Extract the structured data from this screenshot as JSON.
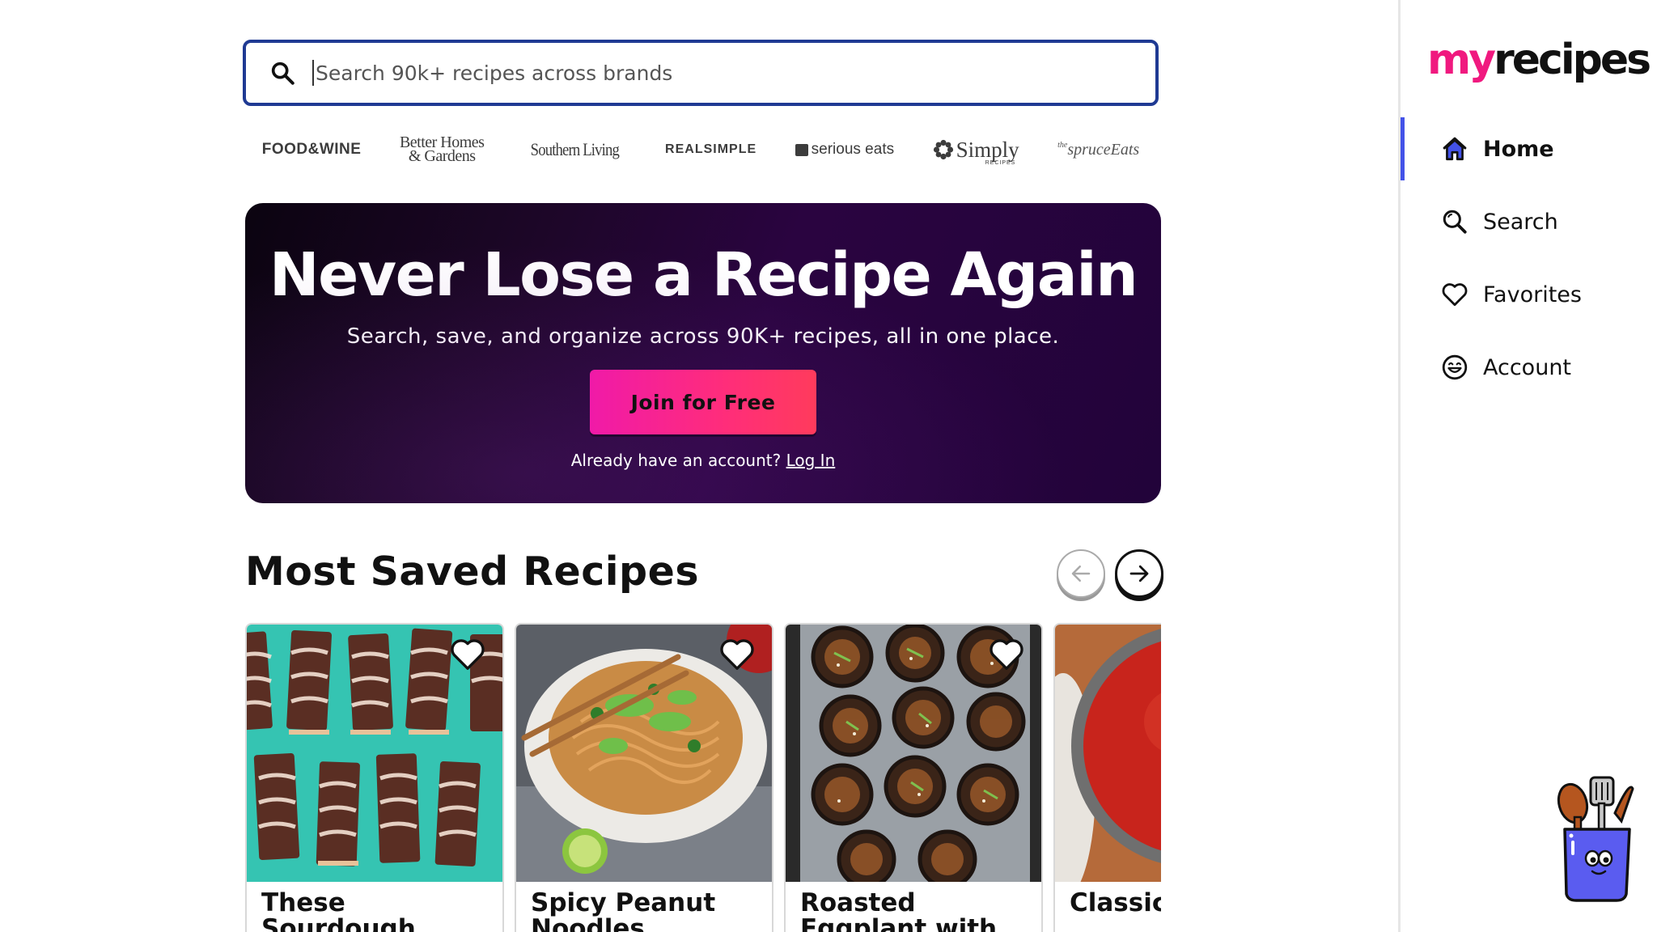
{
  "search": {
    "placeholder": "Search 90k+ recipes across brands"
  },
  "brands": [
    "FOOD&WINE",
    "Better Homes & Gardens",
    "Southern Living",
    "REAL SIMPLE",
    "serious eats",
    "Simply Recipes",
    "the spruce Eats"
  ],
  "brand_display": {
    "food_wine": "FOOD&WINE",
    "bhg_line1": "Better Homes",
    "bhg_line2": "& Gardens",
    "southern_living": "Southern Living",
    "real_simple": "REALSIMPLE",
    "serious_eats": "serious eats",
    "simply": "Simply",
    "simply_sub": "RECIPES",
    "spruce_the": "the",
    "spruce": "spruceEats"
  },
  "hero": {
    "title": "Never Lose a Recipe Again",
    "subtitle": "Search, save, and organize across 90K+ recipes, all in one place.",
    "cta_label": "Join for Free",
    "login_prompt": "Already have an account?",
    "login_link": "Log In"
  },
  "most_saved": {
    "title": "Most Saved Recipes",
    "cards": [
      {
        "title": "These Sourdough",
        "favorited": false
      },
      {
        "title": "Spicy Peanut Noodles",
        "favorited": false
      },
      {
        "title": "Roasted Eggplant with",
        "favorited": false
      },
      {
        "title": "Classic Sauce",
        "favorited": false
      }
    ]
  },
  "sidebar": {
    "logo_my": "my",
    "logo_recipes": "recipes",
    "nav": [
      {
        "label": "Home",
        "icon": "home-icon",
        "active": true
      },
      {
        "label": "Search",
        "icon": "search-icon",
        "active": false
      },
      {
        "label": "Favorites",
        "icon": "heart-icon",
        "active": false
      },
      {
        "label": "Account",
        "icon": "smiley-face-icon",
        "active": false
      }
    ]
  },
  "colors": {
    "accent_pink": "#f0197f",
    "nav_active": "#4352e8",
    "search_border": "#1f3a93",
    "hero_bg": "#22033a"
  }
}
